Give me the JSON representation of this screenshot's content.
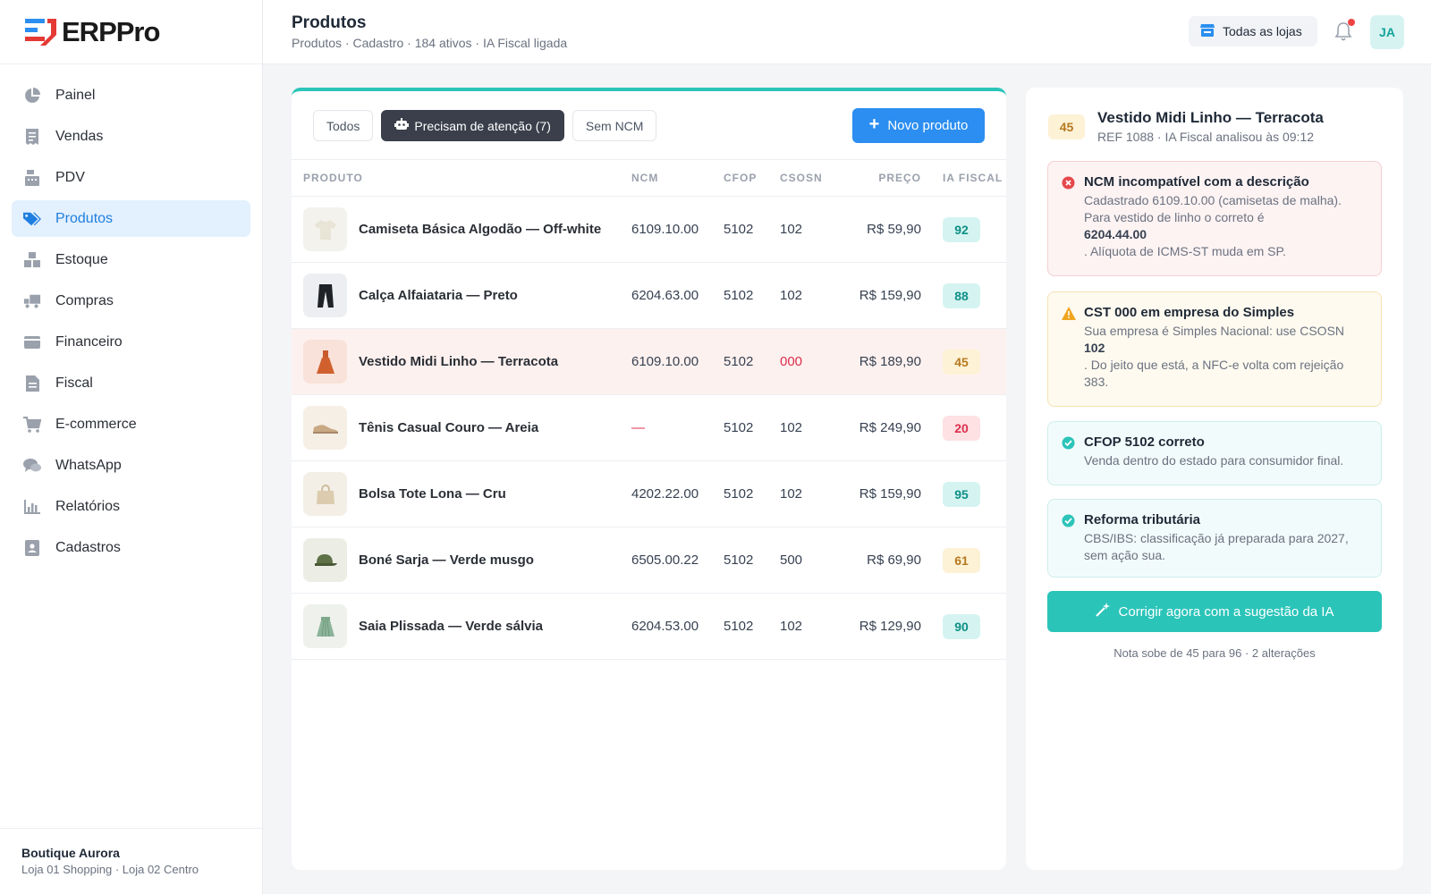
{
  "brand": {
    "name": "ERPPro",
    "accent": "#2b8ef0",
    "teal": "#2bc4b9"
  },
  "sidebar": {
    "items": [
      {
        "label": "Painel",
        "icon": "pie-chart-icon"
      },
      {
        "label": "Vendas",
        "icon": "receipt-icon"
      },
      {
        "label": "PDV",
        "icon": "cash-register-icon"
      },
      {
        "label": "Produtos",
        "icon": "tag-icon",
        "active": true
      },
      {
        "label": "Estoque",
        "icon": "boxes-icon"
      },
      {
        "label": "Compras",
        "icon": "truck-icon"
      },
      {
        "label": "Financeiro",
        "icon": "wallet-icon"
      },
      {
        "label": "Fiscal",
        "icon": "document-icon"
      },
      {
        "label": "E-commerce",
        "icon": "cart-icon"
      },
      {
        "label": "WhatsApp",
        "icon": "chat-icon"
      },
      {
        "label": "Relatórios",
        "icon": "bar-chart-icon"
      },
      {
        "label": "Cadastros",
        "icon": "contact-card-icon"
      }
    ],
    "footer": {
      "store": "Boutique Aurora",
      "branches": "Loja 01 Shopping · Loja 02 Centro"
    }
  },
  "header": {
    "title": "Produtos",
    "subtitle": "Produtos · Cadastro · 184 ativos · IA Fiscal ligada",
    "store_select": "Todas as lojas",
    "avatar": "JA"
  },
  "main": {
    "tabs": [
      {
        "label": "Todos"
      },
      {
        "label": "Precisam de atenção (7)",
        "active": true
      },
      {
        "label": "Sem NCM"
      }
    ],
    "new_button": "Novo produto",
    "columns": [
      "PRODUTO",
      "NCM",
      "CFOP",
      "CSOSN",
      "PREÇO",
      "IA FISCAL"
    ],
    "rows": [
      {
        "name": "Camiseta Básica Algodão — Off-white",
        "ncm": "6109.10.00",
        "cfop": "5102",
        "csosn": "102",
        "price": "R$ 59,90",
        "score": "92",
        "level": "good",
        "thumb": "tshirt-icon"
      },
      {
        "name": "Calça Alfaiataria — Preto",
        "ncm": "6204.63.00",
        "cfop": "5102",
        "csosn": "102",
        "price": "R$ 159,90",
        "score": "88",
        "level": "good",
        "thumb": "pants-icon"
      },
      {
        "name": "Vestido Midi Linho — Terracota",
        "ncm": "6109.10.00",
        "cfop": "5102",
        "csosn": "000",
        "price": "R$ 189,90",
        "score": "45",
        "level": "mid",
        "thumb": "dress-icon",
        "highlight": true
      },
      {
        "name": "Tênis Casual Couro — Areia",
        "ncm": "—",
        "cfop": "5102",
        "csosn": "102",
        "price": "R$ 249,90",
        "score": "20",
        "level": "bad",
        "thumb": "shoe-icon"
      },
      {
        "name": "Bolsa Tote Lona — Cru",
        "ncm": "4202.22.00",
        "cfop": "5102",
        "csosn": "102",
        "price": "R$ 159,90",
        "score": "95",
        "level": "good",
        "thumb": "bag-icon"
      },
      {
        "name": "Boné Sarja — Verde musgo",
        "ncm": "6505.00.22",
        "cfop": "5102",
        "csosn": "500",
        "price": "R$ 69,90",
        "score": "61",
        "level": "mid",
        "thumb": "cap-icon"
      },
      {
        "name": "Saia Plissada — Verde sálvia",
        "ncm": "6204.53.00",
        "cfop": "5102",
        "csosn": "102",
        "price": "R$ 129,90",
        "score": "90",
        "level": "good",
        "thumb": "skirt-icon"
      }
    ]
  },
  "detail": {
    "score": "45",
    "title": "Vestido Midi Linho — Terracota",
    "subtitle": "REF 1088 · IA Fiscal analisou às 09:12",
    "cards": {
      "error": {
        "title": "NCM incompatível com a descrição",
        "text1": "Cadastrado 6109.10.00 (camisetas de malha). Para vestido de linho o correto é",
        "bold": "6204.44.00",
        "text2": ". Alíquota de ICMS-ST muda em SP."
      },
      "warning": {
        "title": "CST 000 em empresa do Simples",
        "text1": "Sua empresa é Simples Nacional: use CSOSN",
        "bold": "102",
        "text2": ". Do jeito que está, a NFC-e volta com rejeição 383."
      },
      "ok_cfop": {
        "title": "CFOP 5102 correto",
        "text": "Venda dentro do estado para consumidor final."
      },
      "ok_reform": {
        "title": "Reforma tributária",
        "text": "CBS/IBS: classificação já preparada para 2027, sem ação sua."
      }
    },
    "fix_button": "Corrigir agora com a sugestão da IA",
    "fix_note": "Nota sobe de 45 para 96 · 2 alterações"
  }
}
